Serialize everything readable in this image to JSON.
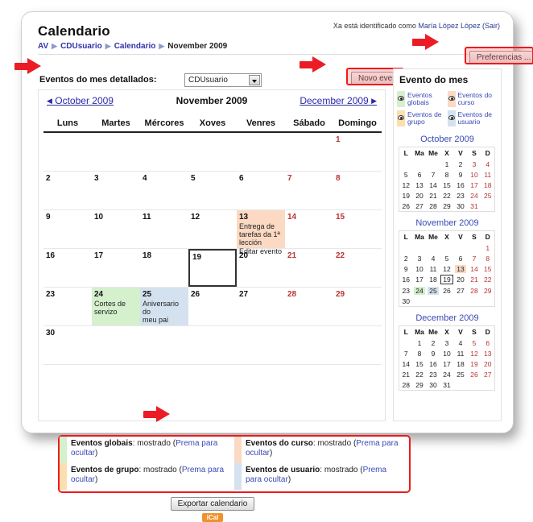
{
  "header": {
    "title": "Calendario",
    "login_prefix": "Xa está identificado como ",
    "login_user": "María López López",
    "login_logout": "(Sair)",
    "preferences_button": "Preferencias ...",
    "breadcrumb": [
      {
        "label": "AV",
        "link": true
      },
      {
        "label": "CDUsuario",
        "link": true
      },
      {
        "label": "Calendario",
        "link": true
      },
      {
        "label": "November 2009",
        "link": false
      }
    ],
    "breadcrumb_separator": "▶"
  },
  "toolbar": {
    "detail_label": "Eventos do mes detallados:",
    "detail_select_value": "CDUsuario",
    "new_event_button": "Novo evento"
  },
  "calendar": {
    "prev_month": "October 2009",
    "current_month": "November 2009",
    "next_month": "December 2009",
    "prev_arrow": "◀",
    "next_arrow": "▶",
    "weekday_headers": [
      "Luns",
      "Martes",
      "Mércores",
      "Xoves",
      "Venres",
      "Sábado",
      "Domingo"
    ],
    "weeks": [
      [
        {
          "day": ""
        },
        {
          "day": ""
        },
        {
          "day": ""
        },
        {
          "day": ""
        },
        {
          "day": ""
        },
        {
          "day": ""
        },
        {
          "day": "1",
          "weekend": true
        }
      ],
      [
        {
          "day": "2"
        },
        {
          "day": "3"
        },
        {
          "day": "4"
        },
        {
          "day": "5"
        },
        {
          "day": "6"
        },
        {
          "day": "7",
          "weekend": true
        },
        {
          "day": "8",
          "weekend": true
        }
      ],
      [
        {
          "day": "9"
        },
        {
          "day": "10"
        },
        {
          "day": "11"
        },
        {
          "day": "12"
        },
        {
          "day": "13",
          "type": "course",
          "event_lines": [
            "Entrega de",
            "tarefas da 1ª",
            "lección"
          ],
          "event_action": "Editar evento"
        },
        {
          "day": "14",
          "weekend": true
        },
        {
          "day": "15",
          "weekend": true
        }
      ],
      [
        {
          "day": "16"
        },
        {
          "day": "17"
        },
        {
          "day": "18"
        },
        {
          "day": "19",
          "type": "today"
        },
        {
          "day": "20"
        },
        {
          "day": "21",
          "weekend": true
        },
        {
          "day": "22",
          "weekend": true
        }
      ],
      [
        {
          "day": "23"
        },
        {
          "day": "24",
          "type": "group",
          "event_lines": [
            "Cortes de",
            "servizo"
          ]
        },
        {
          "day": "25",
          "type": "user",
          "event_lines": [
            "Aniversario do",
            "meu pai"
          ]
        },
        {
          "day": "26"
        },
        {
          "day": "27"
        },
        {
          "day": "28",
          "weekend": true
        },
        {
          "day": "29",
          "weekend": true
        }
      ],
      [
        {
          "day": "30"
        },
        {
          "day": ""
        },
        {
          "day": ""
        },
        {
          "day": ""
        },
        {
          "day": ""
        },
        {
          "day": ""
        },
        {
          "day": ""
        }
      ]
    ]
  },
  "legend_box": {
    "items": [
      {
        "name": "Eventos globais",
        "state": "mostrado",
        "action_open": "(",
        "action": "Prema para ocultar",
        "action_close": ")",
        "swatch": "sw-global"
      },
      {
        "name": "Eventos do curso",
        "state": "mostrado",
        "action_open": "(",
        "action": "Prema para ocultar",
        "action_close": ")",
        "swatch": "sw-course"
      },
      {
        "name": "Eventos de grupo",
        "state": "mostrado",
        "action_open": "(",
        "action": "Prema para ocultar",
        "action_close": ")",
        "swatch": "sw-group"
      },
      {
        "name": "Eventos de usuario",
        "state": "mostrado",
        "action_open": "(",
        "action": "Prema para ocultar",
        "action_close": ")",
        "swatch": "sw-user"
      }
    ]
  },
  "export": {
    "button": "Exportar calendario",
    "badge": "iCal"
  },
  "right_panel": {
    "title": "Evento do mes",
    "legend": [
      {
        "label_line1": "Eventos",
        "label_line2": "globais",
        "icon": "eye-icon",
        "swatch": "sw-global"
      },
      {
        "label_line1": "Eventos do",
        "label_line2": "curso",
        "icon": "eye-icon",
        "swatch": "sw-course"
      },
      {
        "label_line1": "Eventos de",
        "label_line2": "grupo",
        "icon": "eye-icon",
        "swatch": "sw-group"
      },
      {
        "label_line1": "Eventos de",
        "label_line2": "usuario",
        "icon": "eye-icon",
        "swatch": "sw-user"
      }
    ],
    "mini_headers": [
      "L",
      "Ma",
      "Me",
      "X",
      "V",
      "S",
      "D"
    ],
    "months": [
      {
        "title": "October 2009",
        "weeks": [
          [
            {
              "d": ""
            },
            {
              "d": ""
            },
            {
              "d": ""
            },
            {
              "d": "1"
            },
            {
              "d": "2"
            },
            {
              "d": "3",
              "we": true
            },
            {
              "d": "4",
              "we": true
            }
          ],
          [
            {
              "d": "5"
            },
            {
              "d": "6"
            },
            {
              "d": "7"
            },
            {
              "d": "8"
            },
            {
              "d": "9"
            },
            {
              "d": "10",
              "we": true
            },
            {
              "d": "11",
              "we": true
            }
          ],
          [
            {
              "d": "12"
            },
            {
              "d": "13"
            },
            {
              "d": "14"
            },
            {
              "d": "15"
            },
            {
              "d": "16"
            },
            {
              "d": "17",
              "we": true
            },
            {
              "d": "18",
              "we": true
            }
          ],
          [
            {
              "d": "19"
            },
            {
              "d": "20"
            },
            {
              "d": "21"
            },
            {
              "d": "22"
            },
            {
              "d": "23"
            },
            {
              "d": "24",
              "we": true
            },
            {
              "d": "25",
              "we": true
            }
          ],
          [
            {
              "d": "26"
            },
            {
              "d": "27"
            },
            {
              "d": "28"
            },
            {
              "d": "29"
            },
            {
              "d": "30"
            },
            {
              "d": "31",
              "we": true
            },
            {
              "d": ""
            }
          ]
        ]
      },
      {
        "title": "November 2009",
        "weeks": [
          [
            {
              "d": ""
            },
            {
              "d": ""
            },
            {
              "d": ""
            },
            {
              "d": ""
            },
            {
              "d": ""
            },
            {
              "d": ""
            },
            {
              "d": "1",
              "we": true
            }
          ],
          [
            {
              "d": "2"
            },
            {
              "d": "3"
            },
            {
              "d": "4"
            },
            {
              "d": "5"
            },
            {
              "d": "6"
            },
            {
              "d": "7",
              "we": true
            },
            {
              "d": "8",
              "we": true
            }
          ],
          [
            {
              "d": "9"
            },
            {
              "d": "10"
            },
            {
              "d": "11"
            },
            {
              "d": "12"
            },
            {
              "d": "13",
              "type": "course",
              "we": false
            },
            {
              "d": "14",
              "we": true
            },
            {
              "d": "15",
              "we": true
            }
          ],
          [
            {
              "d": "16"
            },
            {
              "d": "17"
            },
            {
              "d": "18"
            },
            {
              "d": "19",
              "type": "today"
            },
            {
              "d": "20"
            },
            {
              "d": "21",
              "we": true
            },
            {
              "d": "22",
              "we": true
            }
          ],
          [
            {
              "d": "23"
            },
            {
              "d": "24",
              "type": "group"
            },
            {
              "d": "25",
              "type": "user"
            },
            {
              "d": "26"
            },
            {
              "d": "27"
            },
            {
              "d": "28",
              "we": true
            },
            {
              "d": "29",
              "we": true
            }
          ],
          [
            {
              "d": "30"
            },
            {
              "d": ""
            },
            {
              "d": ""
            },
            {
              "d": ""
            },
            {
              "d": ""
            },
            {
              "d": ""
            },
            {
              "d": ""
            }
          ]
        ]
      },
      {
        "title": "December 2009",
        "weeks": [
          [
            {
              "d": ""
            },
            {
              "d": "1"
            },
            {
              "d": "2"
            },
            {
              "d": "3"
            },
            {
              "d": "4"
            },
            {
              "d": "5",
              "we": true
            },
            {
              "d": "6",
              "we": true
            }
          ],
          [
            {
              "d": "7"
            },
            {
              "d": "8"
            },
            {
              "d": "9"
            },
            {
              "d": "10"
            },
            {
              "d": "11"
            },
            {
              "d": "12",
              "we": true
            },
            {
              "d": "13",
              "we": true
            }
          ],
          [
            {
              "d": "14"
            },
            {
              "d": "15"
            },
            {
              "d": "16"
            },
            {
              "d": "17"
            },
            {
              "d": "18"
            },
            {
              "d": "19",
              "we": true
            },
            {
              "d": "20",
              "we": true
            }
          ],
          [
            {
              "d": "21"
            },
            {
              "d": "22"
            },
            {
              "d": "23"
            },
            {
              "d": "24"
            },
            {
              "d": "25"
            },
            {
              "d": "26",
              "we": true
            },
            {
              "d": "27",
              "we": true
            }
          ],
          [
            {
              "d": "28"
            },
            {
              "d": "29"
            },
            {
              "d": "30"
            },
            {
              "d": "31"
            },
            {
              "d": ""
            },
            {
              "d": ""
            },
            {
              "d": ""
            }
          ]
        ]
      }
    ]
  },
  "colors": {
    "accent_red": "#ee1b1b",
    "course": "#fbd9c2",
    "group": "#d4f0cd",
    "user": "#d3e2ee",
    "global": "#d4f0cd",
    "link": "#3b49b5",
    "weekend": "#b33333",
    "ical_badge": "#f0922b"
  }
}
